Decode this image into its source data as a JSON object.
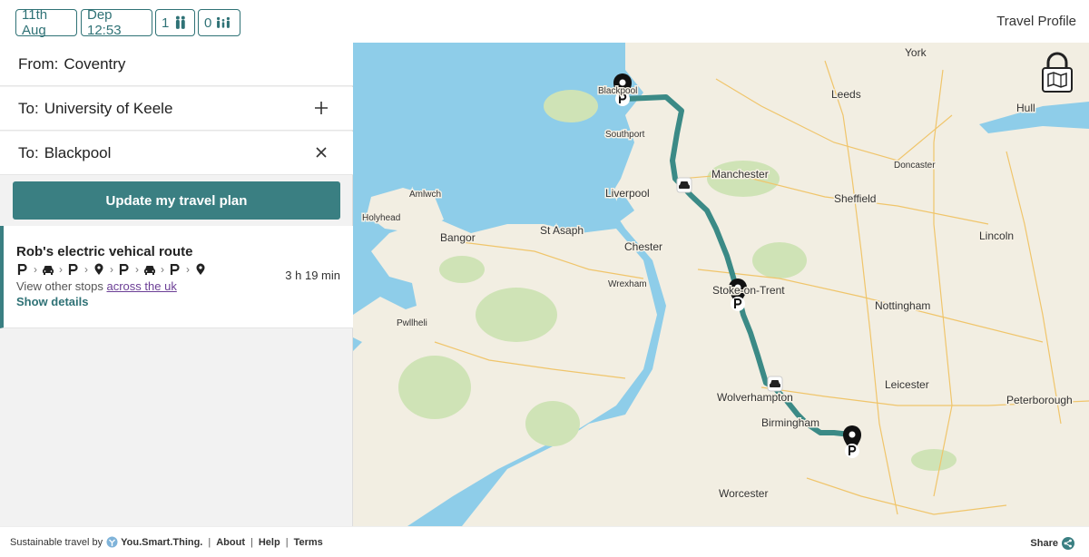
{
  "header": {
    "date": "11th Aug",
    "departure": "Dep 12:53",
    "adults": "1",
    "children": "0",
    "profile_link": "Travel Profile"
  },
  "journey": {
    "from_label": "From:",
    "from_value": "Coventry",
    "stops": [
      {
        "label": "To:",
        "value": "University of Keele",
        "action": "add-icon"
      },
      {
        "label": "To:",
        "value": "Blackpool",
        "action": "close-icon"
      }
    ],
    "update_button": "Update my travel plan"
  },
  "route": {
    "title": "Rob's electric vehical route",
    "steps": [
      "parking-icon",
      "car-icon",
      "parking-icon",
      "pin-icon",
      "parking-icon",
      "car-icon",
      "parking-icon",
      "pin-icon"
    ],
    "duration": "3 h 19 min",
    "other_stops_text": "View other stops",
    "other_stops_link": "across the uk",
    "details_link": "Show details"
  },
  "map": {
    "cities": [
      "York",
      "Leeds",
      "Hull",
      "Blackpool",
      "Southport",
      "Doncaster",
      "Manchester",
      "Amlwch",
      "Liverpool",
      "Sheffield",
      "Holyhead",
      "St Asaph",
      "Bangor",
      "Lincoln",
      "Chester",
      "Wrexham",
      "Stoke-on-Trent",
      "Nottingham",
      "Pwllheli",
      "Leicester",
      "Wolverhampton",
      "Peterborough",
      "Birmingham",
      "Worcester"
    ],
    "route_color": "#3b8a86",
    "sea_color": "#8ecde9",
    "land_color": "#f2eee2"
  },
  "footer": {
    "prefix": "Sustainable travel by",
    "brand": "You.Smart.Thing.",
    "links": [
      "About",
      "Help",
      "Terms"
    ],
    "share": "Share"
  }
}
